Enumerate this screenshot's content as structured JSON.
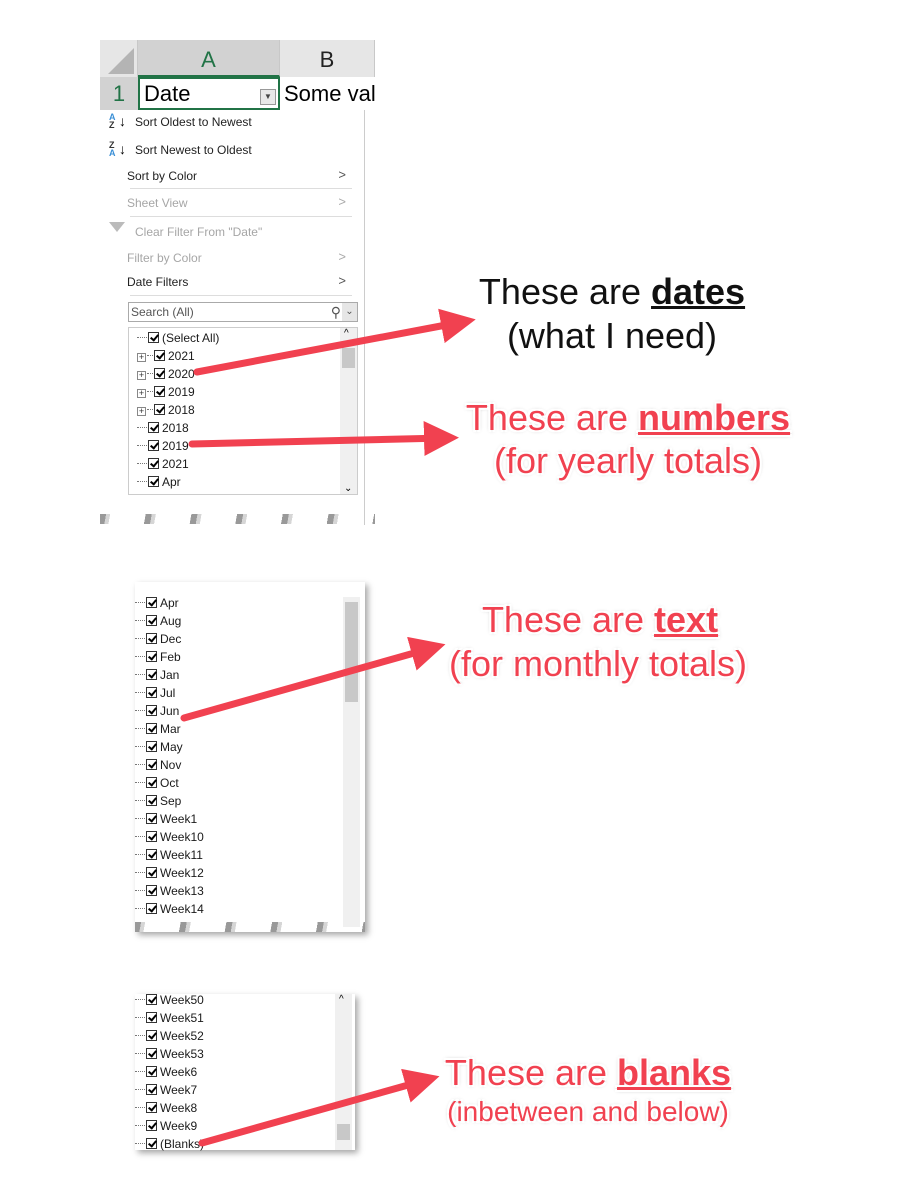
{
  "sheet": {
    "columns": [
      "A",
      "B"
    ],
    "row_number": "1",
    "cell_a1": "Date",
    "cell_b1": "Some val"
  },
  "menu": {
    "sort_asc": "Sort Oldest to Newest",
    "sort_desc": "Sort Newest to Oldest",
    "sort_by_color": "Sort by Color",
    "sheet_view": "Sheet View",
    "clear_filter": "Clear Filter From \"Date\"",
    "filter_by_color": "Filter by Color",
    "date_filters": "Date Filters",
    "search_placeholder": "Search (All)"
  },
  "list1": [
    {
      "label": "(Select All)",
      "expand": false
    },
    {
      "label": "2021",
      "expand": true
    },
    {
      "label": "2020",
      "expand": true
    },
    {
      "label": "2019",
      "expand": true
    },
    {
      "label": "2018",
      "expand": true
    },
    {
      "label": "2018",
      "expand": false
    },
    {
      "label": "2019",
      "expand": false
    },
    {
      "label": "2021",
      "expand": false
    },
    {
      "label": "Apr",
      "expand": false
    }
  ],
  "list2": [
    "Apr",
    "Aug",
    "Dec",
    "Feb",
    "Jan",
    "Jul",
    "Jun",
    "Mar",
    "May",
    "Nov",
    "Oct",
    "Sep",
    "Week1",
    "Week10",
    "Week11",
    "Week12",
    "Week13",
    "Week14"
  ],
  "list3": [
    "Week50",
    "Week51",
    "Week52",
    "Week53",
    "Week6",
    "Week7",
    "Week8",
    "Week9",
    "(Blanks)"
  ],
  "annotations": [
    {
      "prefix": "These are ",
      "bold": "dates",
      "sub": "(what I need)",
      "color": "#111111"
    },
    {
      "prefix": "These are ",
      "bold": "numbers",
      "sub": "(for yearly totals)",
      "color": "#f14150"
    },
    {
      "prefix": "These are ",
      "bold": "text",
      "sub": "(for monthly totals)",
      "color": "#f14150"
    },
    {
      "prefix": "These are ",
      "bold": "blanks",
      "sub": "(inbetween and below)",
      "color": "#f14150"
    }
  ],
  "colors": {
    "arrow": "#f14150",
    "excel_green": "#217346"
  }
}
